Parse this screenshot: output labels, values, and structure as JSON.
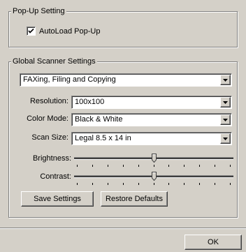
{
  "popup": {
    "title": "Pop-Up Setting",
    "autoload_label": "AutoLoad Pop-Up",
    "autoload_checked": true
  },
  "scanner": {
    "title": "Global Scanner Settings",
    "profile": "FAXing, Filing and Copying",
    "resolution_label": "Resolution:",
    "resolution": "100x100",
    "color_mode_label": "Color Mode:",
    "color_mode": "Black & White",
    "scan_size_label": "Scan Size:",
    "scan_size": "Legal 8.5 x 14 in",
    "brightness_label": "Brightness:",
    "brightness_level": 0.5,
    "contrast_label": "Contrast:",
    "contrast_level": 0.5,
    "save_label": "Save Settings",
    "restore_label": "Restore Defaults"
  },
  "footer": {
    "ok_label": "OK"
  }
}
